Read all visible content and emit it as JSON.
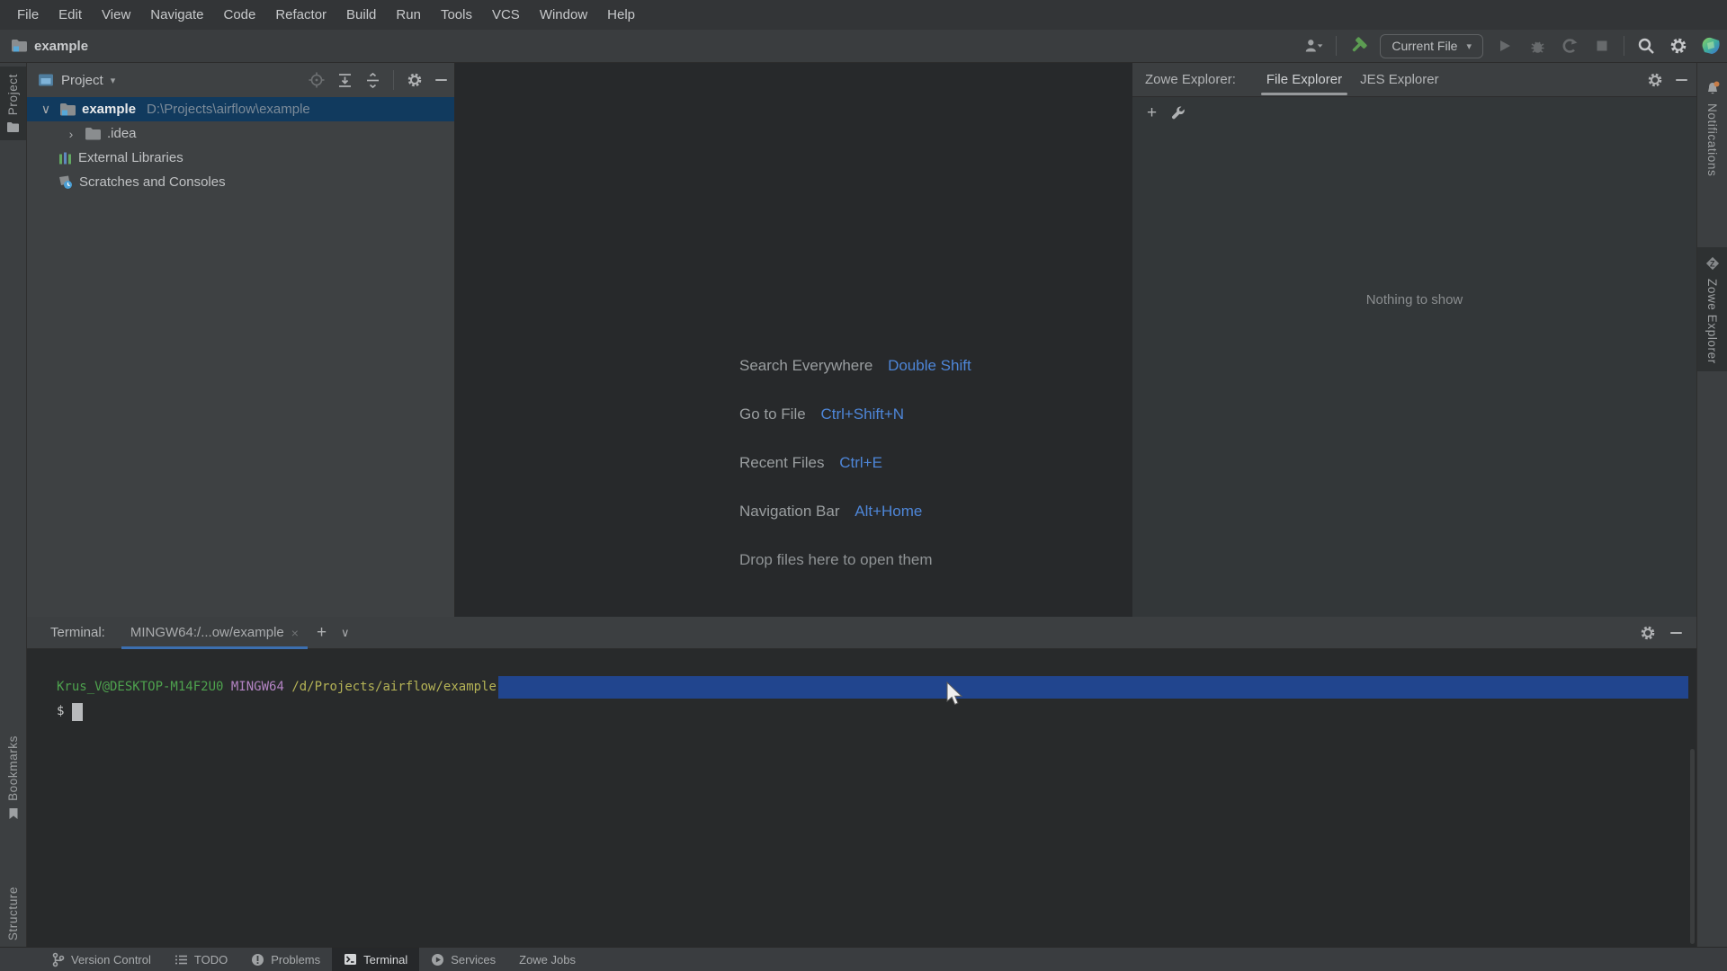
{
  "menubar": {
    "items": [
      "File",
      "Edit",
      "View",
      "Navigate",
      "Code",
      "Refactor",
      "Build",
      "Run",
      "Tools",
      "VCS",
      "Window",
      "Help"
    ]
  },
  "navbar": {
    "project": "example"
  },
  "toolbar": {
    "run_config": "Current File"
  },
  "project_panel": {
    "title": "Project",
    "tree": [
      {
        "name": "example",
        "path": "D:\\Projects\\airflow\\example"
      },
      {
        "name": ".idea"
      },
      {
        "name": "External Libraries"
      },
      {
        "name": "Scratches and Consoles"
      }
    ]
  },
  "editor_hints": {
    "lines": [
      {
        "label": "Search Everywhere",
        "shortcut": "Double Shift"
      },
      {
        "label": "Go to File",
        "shortcut": "Ctrl+Shift+N"
      },
      {
        "label": "Recent Files",
        "shortcut": "Ctrl+E"
      },
      {
        "label": "Navigation Bar",
        "shortcut": "Alt+Home"
      },
      {
        "label": "Drop files here to open them",
        "shortcut": ""
      }
    ]
  },
  "zowe_panel": {
    "label": "Zowe Explorer:",
    "tabs": [
      "File Explorer",
      "JES Explorer"
    ],
    "empty_text": "Nothing to show"
  },
  "terminal": {
    "label": "Terminal:",
    "tab_title": "MINGW64:/...ow/example",
    "prompt_user": "Krus_V@DESKTOP-M14F2U0",
    "prompt_env": "MINGW64",
    "prompt_path": "/d/Projects/airflow/example",
    "prompt_symbol": "$"
  },
  "statusbar": {
    "items": [
      "Version Control",
      "TODO",
      "Problems",
      "Terminal",
      "Services",
      "Zowe Jobs"
    ]
  },
  "left_stripe": {
    "project": "Project",
    "bookmarks": "Bookmarks",
    "structure": "Structure"
  },
  "right_stripe": {
    "notifications": "Notifications",
    "zowe": "Zowe Explorer"
  },
  "icons": {
    "chevron_down": "▾",
    "tree_open": "∨",
    "tree_closed": "›",
    "close": "×",
    "plus": "+",
    "tab_chevron": "∨"
  },
  "colors": {
    "hint_shortcut_blue": "#4e86d8",
    "terminal_selection_blue": "#21458e",
    "terminal_green": "#4ea24e",
    "terminal_purple": "#b484c4",
    "terminal_yellow": "#b5b356",
    "tab_underline_blue": "#3c6fb0",
    "hammer_green": "#5c9c52",
    "notification_badge_orange": "#c77d48",
    "tree_selection": "#113a5e"
  }
}
